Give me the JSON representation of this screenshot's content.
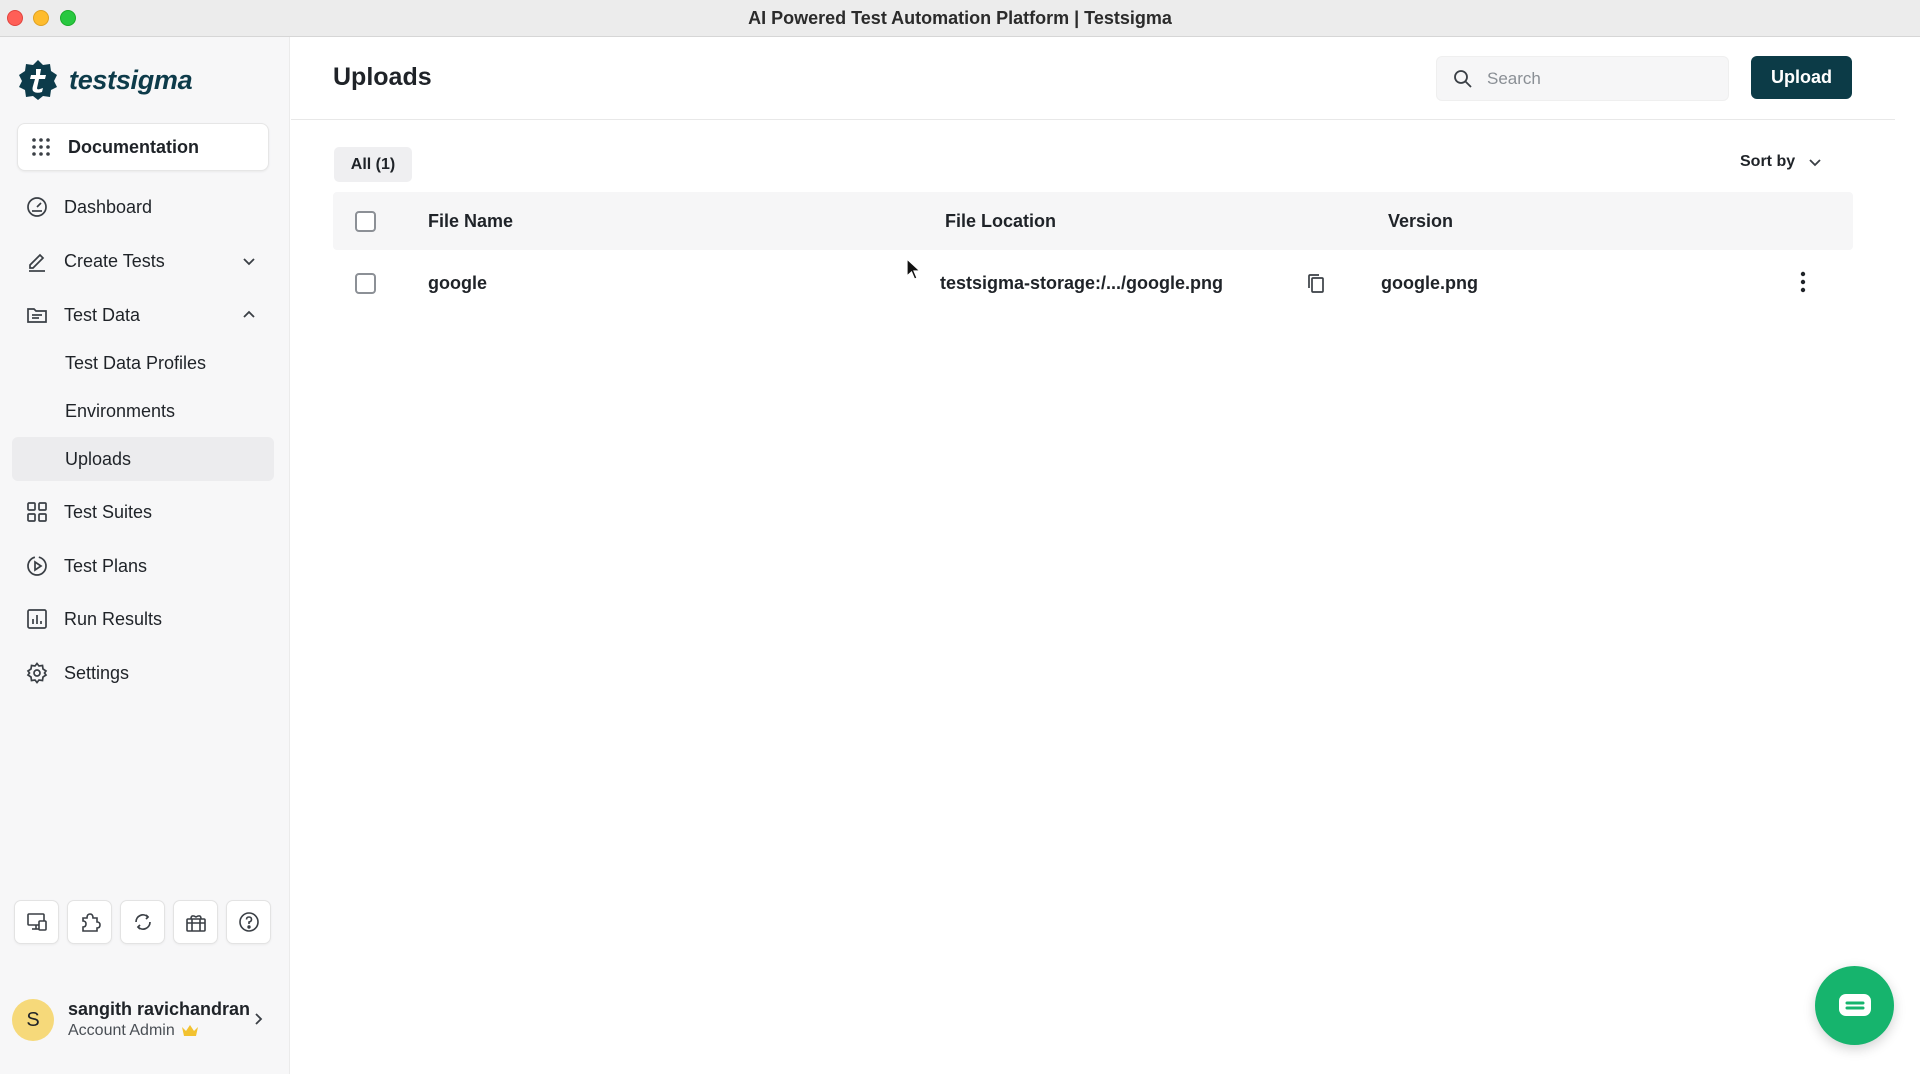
{
  "window": {
    "title": "AI Powered Test Automation Platform | Testsigma"
  },
  "brand": {
    "name": "testsigma",
    "color": "#0d3b4a"
  },
  "sidebar": {
    "documentation_label": "Documentation",
    "nav": {
      "dashboard": "Dashboard",
      "create_tests": "Create Tests",
      "test_data": "Test Data",
      "test_data_profiles": "Test Data Profiles",
      "environments": "Environments",
      "uploads": "Uploads",
      "test_suites": "Test Suites",
      "test_plans": "Test Plans",
      "run_results": "Run Results",
      "settings": "Settings"
    },
    "tools": [
      "agent-icon",
      "addons-icon",
      "sync-icon",
      "gift-icon",
      "help-icon"
    ],
    "user": {
      "initial": "S",
      "name": "sangith ravichandran",
      "role": "Account Admin"
    }
  },
  "main": {
    "title": "Uploads",
    "search_placeholder": "Search",
    "upload_label": "Upload",
    "filter_label": "All (1)",
    "sort_label": "Sort by",
    "columns": {
      "file_name": "File Name",
      "file_location": "File Location",
      "version": "Version"
    },
    "rows": [
      {
        "file_name": "google",
        "file_location": "testsigma-storage:/.../google.png",
        "version": "google.png"
      }
    ]
  },
  "colors": {
    "primary_button": "#0c3b47",
    "chat_button": "#16b46d",
    "active_nav_bg": "#ececee",
    "crown": "#f2c230"
  }
}
